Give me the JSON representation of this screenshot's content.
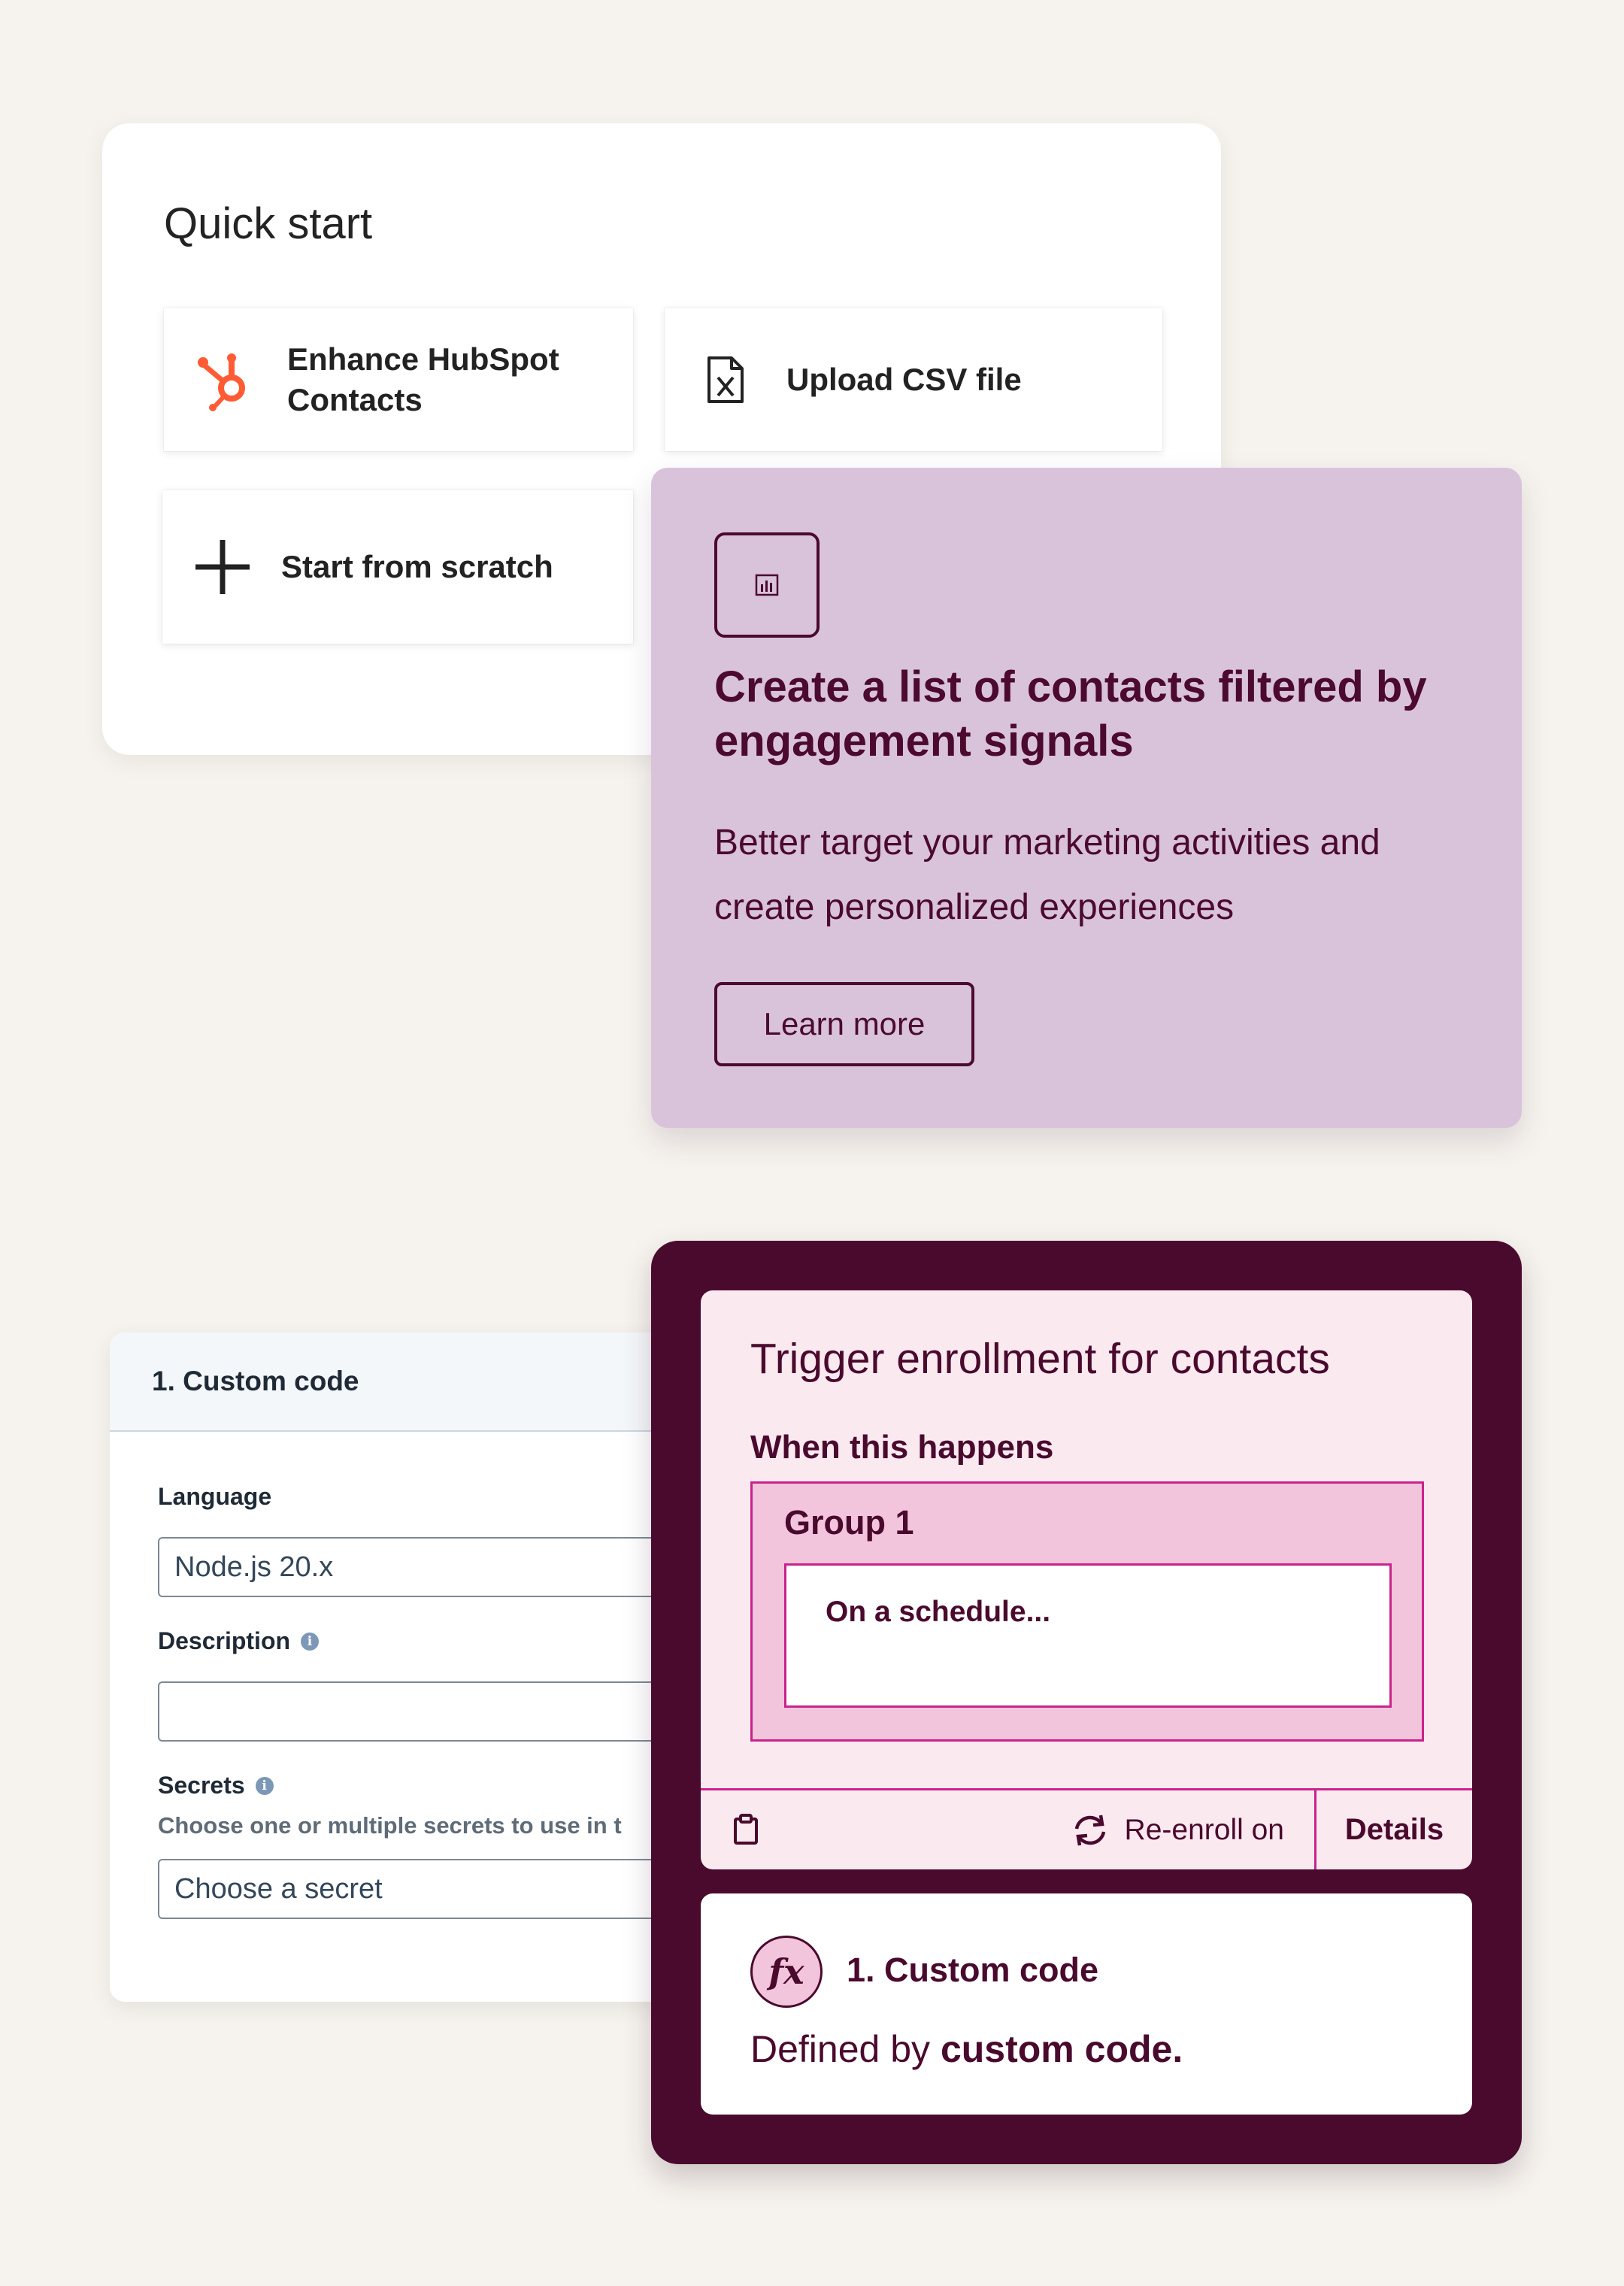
{
  "quick_start": {
    "title": "Quick start",
    "tiles": [
      {
        "label": "Enhance HubSpot Contacts",
        "icon": "hubspot-logo-icon"
      },
      {
        "label": "Upload CSV file",
        "icon": "csv-file-icon"
      },
      {
        "label": "Start from scratch",
        "icon": "plus-icon"
      }
    ]
  },
  "promo": {
    "icon": "chart-icon",
    "title": "Create a list of contacts filtered by engagement signals",
    "body": "Better target your marketing activities and create personalized experiences",
    "button_label": "Learn more"
  },
  "custom_code_panel": {
    "header": "1. Custom code",
    "language_label": "Language",
    "language_value": "Node.js 20.x",
    "description_label": "Description",
    "description_value": "",
    "secrets_label": "Secrets",
    "secrets_help": "Choose one or multiple secrets to use in t",
    "secrets_placeholder": "Choose a secret"
  },
  "workflow": {
    "trigger_title": "Trigger enrollment for contacts",
    "trigger_subtitle": "When this happens",
    "group_label": "Group 1",
    "condition": "On a schedule...",
    "reenroll_label": "Re-enroll on",
    "details_label": "Details",
    "action_icon": "fx",
    "action_title": "1. Custom code",
    "action_desc_prefix": "Defined by ",
    "action_desc_bold": "custom code."
  },
  "colors": {
    "background": "#f6f3ee",
    "hubspot_orange": "#ff5c35",
    "promo_bg": "#d9c3da",
    "plum": "#4a0a2d",
    "magenta_border": "#c9238b",
    "light_pink": "#fbe9f0",
    "group_pink": "#f2c5dc"
  }
}
